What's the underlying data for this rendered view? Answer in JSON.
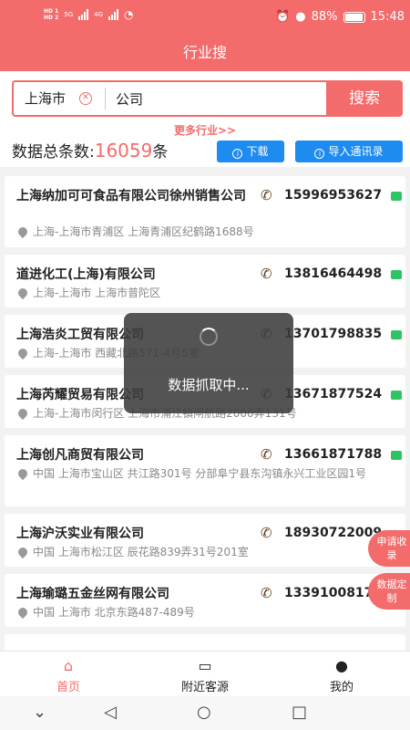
{
  "status_bar": {
    "hd1": "HD 1",
    "hd2": "HD 2",
    "net1": "5G",
    "net2": "4G",
    "battery": "88%",
    "time": "15:48"
  },
  "header": {
    "title": "行业搜"
  },
  "search": {
    "city": "上海市",
    "keyword": "公司",
    "button": "搜索",
    "more": "更多行业>>"
  },
  "summary": {
    "prefix": "数据总条数:",
    "count": "16059",
    "suffix": "条",
    "download": "下载",
    "import": "导入通讯录"
  },
  "results": [
    {
      "name": "上海纳加可可食品有限公司徐州销售公司",
      "phone": "15996953627",
      "address": "上海-上海市青浦区 上海青浦区纪鹤路1688号"
    },
    {
      "name": "道进化工(上海)有限公司",
      "phone": "13816464498",
      "address": "上海-上海市 上海市普陀区"
    },
    {
      "name": "上海浩炎工贸有限公司",
      "phone": "13701798835",
      "address": "上海-上海市 西藏北路571-4号5室"
    },
    {
      "name": "上海芮耀贸易有限公司",
      "phone": "13671877524",
      "address": "上海-上海市闵行区 上海市浦江镇闸航路2000弄131号"
    },
    {
      "name": "上海创凡商贸有限公司",
      "phone": "13661871788",
      "address": "中国 上海市宝山区 共江路301号 分部阜宁县东沟镇永兴工业区园1号"
    },
    {
      "name": "上海沪沃实业有限公司",
      "phone": "18930722009",
      "address": "中国 上海市松江区 辰花路839弄31号201室"
    },
    {
      "name": "上海瑜璐五金丝网有限公司",
      "phone": "13391008177",
      "address": "中国 上海市 北京东路487-489号"
    }
  ],
  "floating": {
    "apply": "申请收录",
    "custom": "数据定制"
  },
  "toast": {
    "text": "数据抓取中..."
  },
  "bottom_nav": {
    "home": "首页",
    "nearby": "附近客源",
    "mine": "我的"
  },
  "colors": {
    "accent": "#f36b6b",
    "blue": "#1e8bf0",
    "wechat": "#2ec466"
  }
}
